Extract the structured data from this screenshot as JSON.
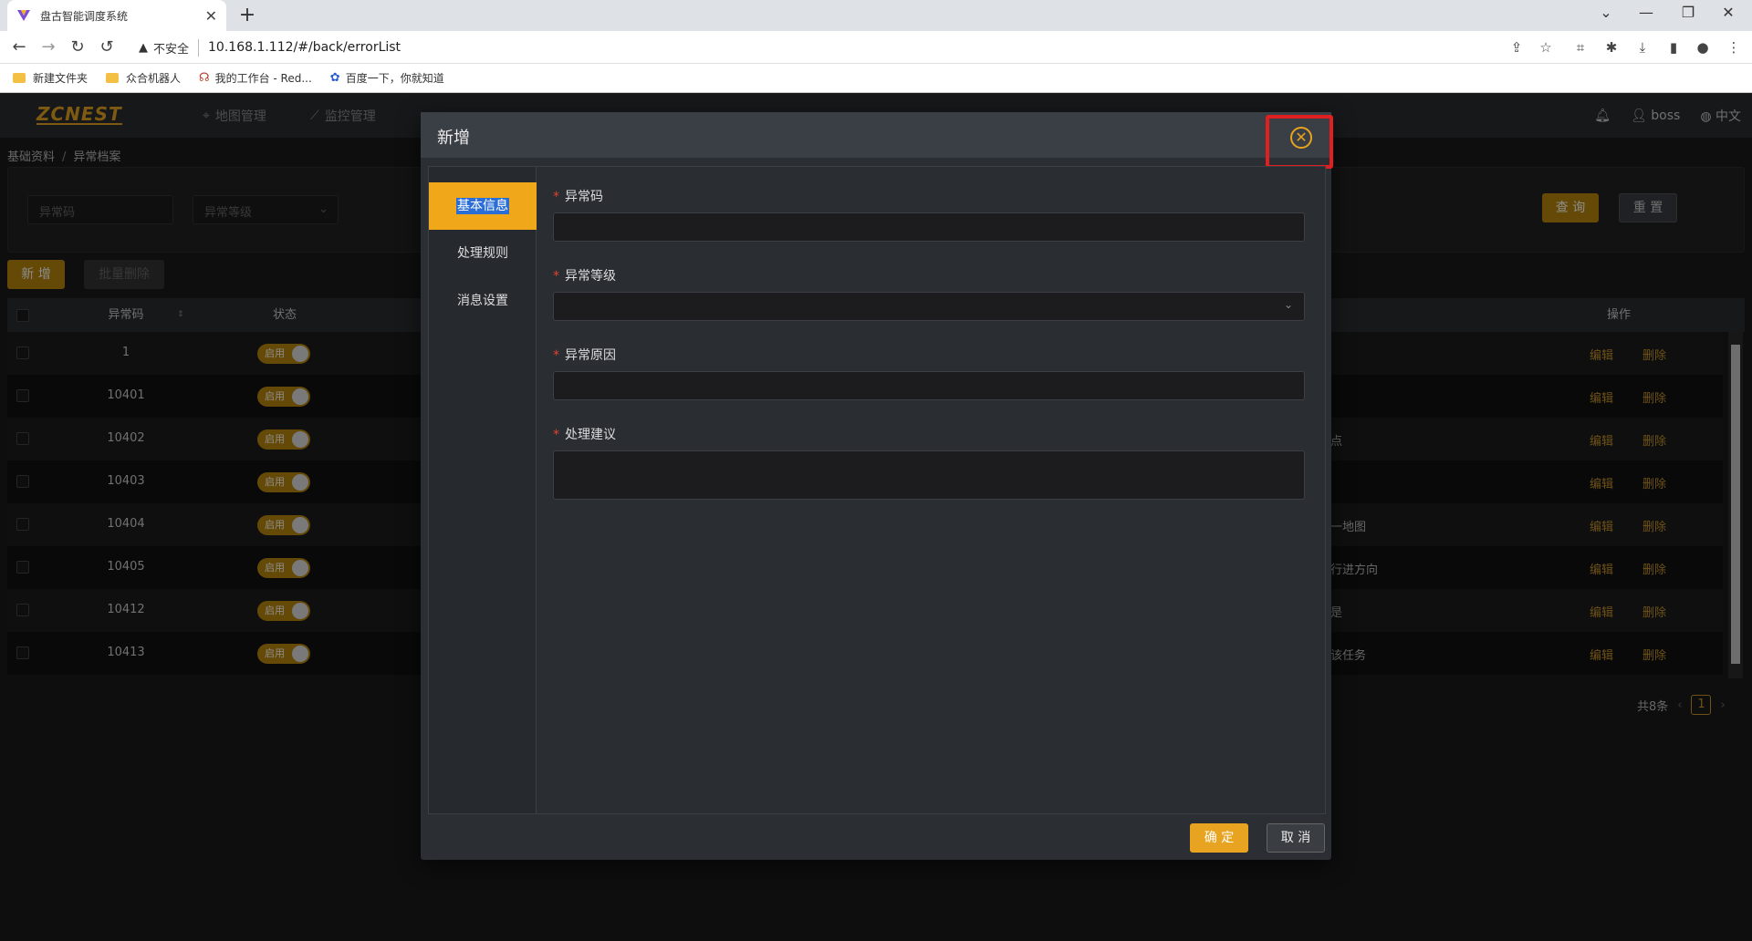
{
  "browser": {
    "tab_title": "盘古智能调度系统",
    "new_tab": "+",
    "insecure_label": "不安全",
    "url": "10.168.1.112/#/back/errorList",
    "bookmarks": [
      "新建文件夹",
      "众合机器人",
      "我的工作台 - Red...",
      "百度一下，你就知道"
    ]
  },
  "app": {
    "logo": "ZCNEST",
    "nav": [
      "地图管理",
      "监控管理"
    ],
    "user": "boss",
    "language": "中文"
  },
  "breadcrumb": {
    "items": [
      "基础资料",
      "异常档案"
    ],
    "separator": "/"
  },
  "filter": {
    "code_placeholder": "异常码",
    "level_placeholder": "异常等级",
    "query_label": "查 询",
    "reset_label": "重 置"
  },
  "toolbar": {
    "add_label": "新 增",
    "batch_delete_label": "批量删除"
  },
  "table": {
    "headers": {
      "code": "异常码",
      "status": "状态",
      "actions": "操作"
    },
    "rows": [
      {
        "code": "1",
        "status": "启用",
        "tail": ""
      },
      {
        "code": "10401",
        "status": "启用",
        "tail": ""
      },
      {
        "code": "10402",
        "status": "启用",
        "tail": "点"
      },
      {
        "code": "10403",
        "status": "启用",
        "tail": ""
      },
      {
        "code": "10404",
        "status": "启用",
        "tail": "一地图"
      },
      {
        "code": "10405",
        "status": "启用",
        "tail": "行进方向"
      },
      {
        "code": "10412",
        "status": "启用",
        "tail": "是"
      },
      {
        "code": "10413",
        "status": "启用",
        "tail": "该任务"
      }
    ],
    "edit_label": "编辑",
    "delete_label": "删除"
  },
  "pagination": {
    "total": "共8条",
    "current_page": "1"
  },
  "modal": {
    "title": "新增",
    "tabs": [
      "基本信息",
      "处理规则",
      "消息设置"
    ],
    "fields": {
      "code_label": "异常码",
      "level_label": "异常等级",
      "reason_label": "异常原因",
      "suggestion_label": "处理建议"
    },
    "required_mark": "*",
    "ok_label": "确 定",
    "cancel_label": "取 消"
  },
  "colors": {
    "accent": "#e8a320",
    "highlight_box": "#e02020"
  }
}
